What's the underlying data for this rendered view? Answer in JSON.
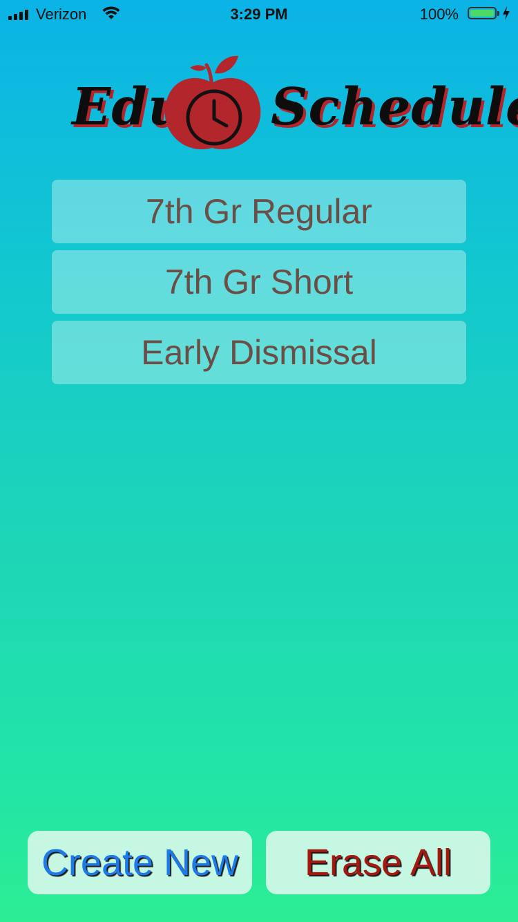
{
  "status_bar": {
    "carrier": "Verizon",
    "time": "3:29 PM",
    "battery_percent": "100%",
    "battery_level": 1.0,
    "battery_color": "#4cd964"
  },
  "logo": {
    "word_left": "Edu",
    "word_right": "Schedule",
    "icon": "apple-clock-icon",
    "text_color": "#0d0d0d",
    "shadow_color": "#b3262c"
  },
  "schedules": [
    {
      "label": "7th Gr Regular"
    },
    {
      "label": "7th Gr Short"
    },
    {
      "label": "Early Dismissal"
    }
  ],
  "actions": {
    "create_label": "Create New",
    "erase_label": "Erase All",
    "create_color": "#1c7be8",
    "erase_color": "#a3180f"
  },
  "theme": {
    "gradient_top": "#0bb3e6",
    "gradient_bottom": "#2ced93",
    "item_text_color": "#6b4e46"
  }
}
